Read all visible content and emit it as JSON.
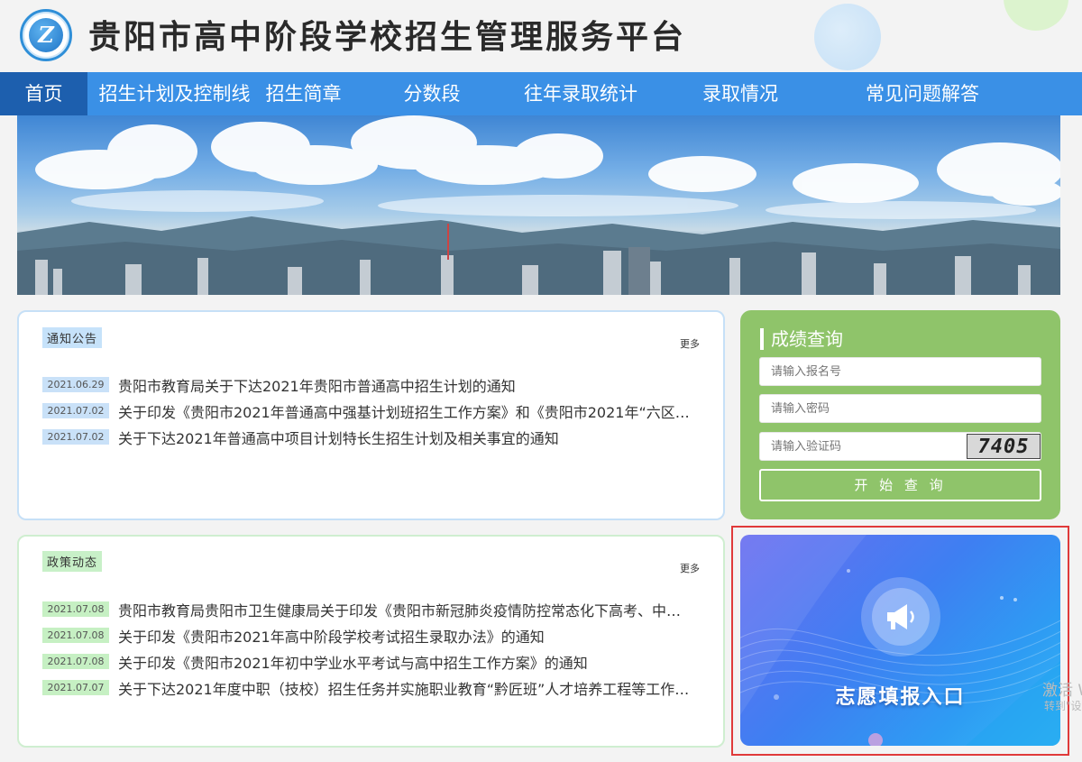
{
  "header": {
    "site_title": "贵阳市高中阶段学校招生管理服务平台",
    "logo_icon": "school-logo"
  },
  "nav": {
    "items": [
      {
        "label": "首页",
        "active": true
      },
      {
        "label": "招生计划及控制线"
      },
      {
        "label": "招生简章"
      },
      {
        "label": "分数段"
      },
      {
        "label": "往年录取统计"
      },
      {
        "label": "录取情况"
      },
      {
        "label": "常见问题解答"
      }
    ]
  },
  "notice": {
    "tag": "通知公告",
    "more": "更多",
    "items": [
      {
        "date": "2021.06.29",
        "title": "贵阳市教育局关于下达2021年贵阳市普通高中招生计划的通知"
      },
      {
        "date": "2021.07.02",
        "title": "关于印发《贵阳市2021年普通高中强基计划班招生工作方案》和《贵阳市2021年“六区…"
      },
      {
        "date": "2021.07.02",
        "title": "关于下达2021年普通高中项目计划特长生招生计划及相关事宜的通知"
      }
    ]
  },
  "policy": {
    "tag": "政策动态",
    "more": "更多",
    "items": [
      {
        "date": "2021.07.08",
        "title": "贵阳市教育局贵阳市卫生健康局关于印发《贵阳市新冠肺炎疫情防控常态化下高考、中…"
      },
      {
        "date": "2021.07.08",
        "title": "关于印发《贵阳市2021年高中阶段学校考试招生录取办法》的通知"
      },
      {
        "date": "2021.07.08",
        "title": "关于印发《贵阳市2021年初中学业水平考试与高中招生工作方案》的通知"
      },
      {
        "date": "2021.07.07",
        "title": "关于下达2021年度中职（技校）招生任务并实施职业教育“黔匠班”人才培养工程等工作…"
      }
    ]
  },
  "query": {
    "title": "成绩查询",
    "username_placeholder": "请输入报名号",
    "password_placeholder": "请输入密码",
    "captcha_placeholder": "请输入验证码",
    "captcha_text": "7405",
    "submit_label": "开 始 查 询"
  },
  "entry": {
    "label": "志愿填报入口",
    "icon": "megaphone-icon"
  },
  "watermark": {
    "line1": "激活 W",
    "line2": "转到\"设"
  },
  "colors": {
    "nav_bg": "#3a90e6",
    "nav_active": "#1d5fae",
    "query_bg": "#8fc46a",
    "highlight_border": "#e03a3a"
  }
}
